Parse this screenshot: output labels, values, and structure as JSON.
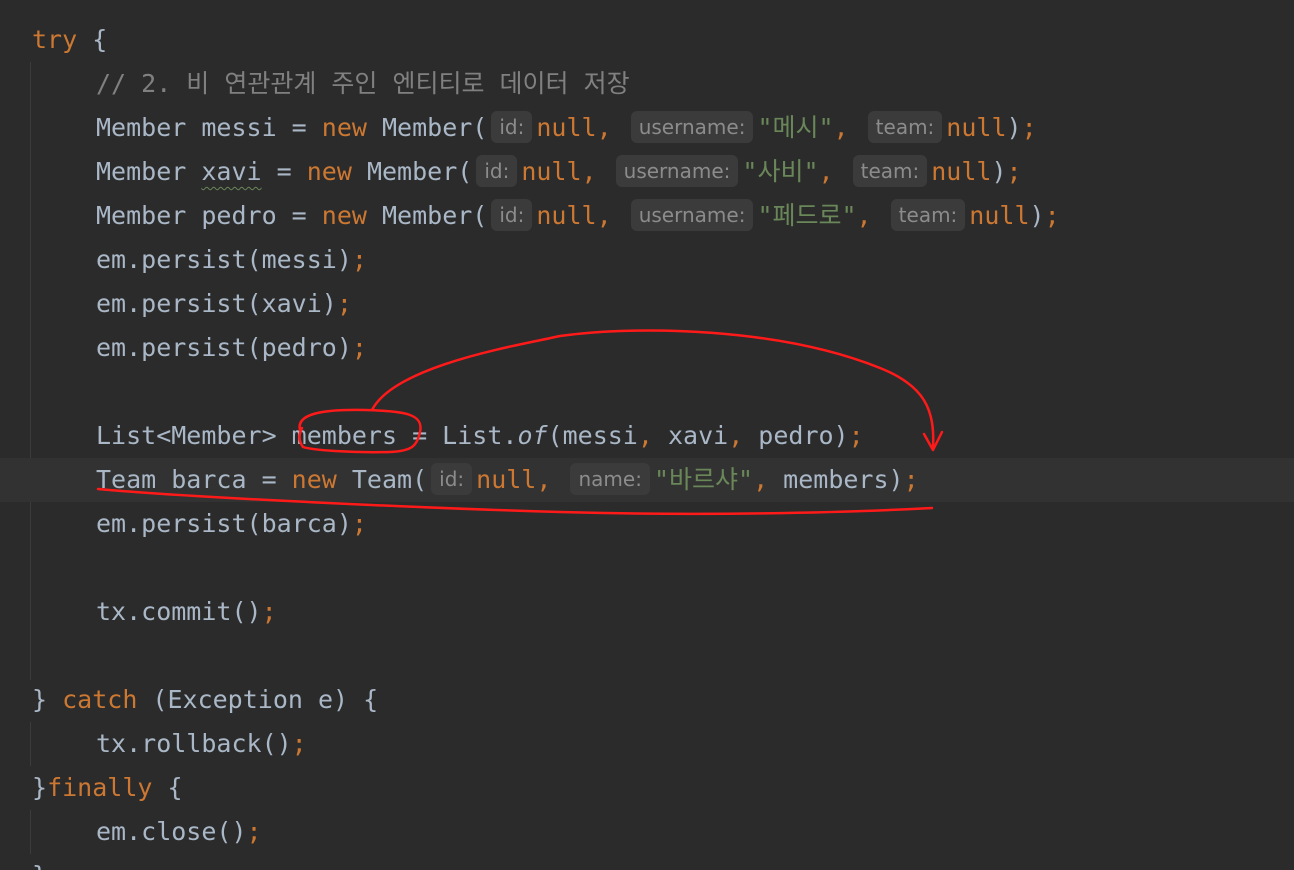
{
  "code": {
    "l1": {
      "kw": "try",
      "rest": " {"
    },
    "l2": {
      "comment": "// 2. 비 연관관계 주인 엔티티로 데이터 저장"
    },
    "l3": {
      "type": "Member",
      "var": " messi = ",
      "kw_new": "new",
      "ctor": " Member(",
      "hint_id": "id:",
      "v1": "null",
      "c1": ",",
      "hint_username": "username:",
      "v2": "\"메시\"",
      "c2": ",",
      "hint_team": "team:",
      "v3": "null",
      "close": ")",
      "semi": ";"
    },
    "l4": {
      "type": "Member ",
      "var_name": "xavi",
      "var_eq": " = ",
      "kw_new": "new",
      "ctor": " Member(",
      "hint_id": "id:",
      "v1": "null",
      "c1": ",",
      "hint_username": "username:",
      "v2": "\"사비\"",
      "c2": ",",
      "hint_team": "team:",
      "v3": "null",
      "close": ")",
      "semi": ";"
    },
    "l5": {
      "type": "Member",
      "var": " pedro = ",
      "kw_new": "new",
      "ctor": " Member(",
      "hint_id": "id:",
      "v1": "null",
      "c1": ",",
      "hint_username": "username:",
      "v2": "\"페드로\"",
      "c2": ",",
      "hint_team": "team:",
      "v3": "null",
      "close": ")",
      "semi": ";"
    },
    "l6": {
      "text": "em.persist(messi)",
      "semi": ";"
    },
    "l7": {
      "text": "em.persist(xavi)",
      "semi": ";"
    },
    "l8": {
      "text": "em.persist(pedro)",
      "semi": ";"
    },
    "l10": {
      "a": "List<Member> members = List.",
      "of": "of",
      "b": "(messi",
      "c1": ",",
      "b2": " xavi",
      "c2": ",",
      "b3": " pedro)",
      "semi": ";"
    },
    "l11": {
      "type": "Team barca = ",
      "kw_new": "new",
      "ctor": " Team(",
      "hint_id": "id:",
      "v1": "null",
      "c1": ",",
      "hint_name": "name:",
      "v2": "\"바르샤\"",
      "c2": ",",
      "rest": " members)",
      "semi": ";"
    },
    "l12": {
      "text": "em.persist(barca)",
      "semi": ";"
    },
    "l14": {
      "text": "tx.commit()",
      "semi": ";"
    },
    "l16": {
      "a": "} ",
      "kw": "catch",
      "rest": " (Exception e) {"
    },
    "l17": {
      "text": "tx.rollback()",
      "semi": ";"
    },
    "l18": {
      "a": "}",
      "kw": "finally",
      "rest": " {"
    },
    "l19": {
      "text": "em.close()",
      "semi": ";"
    },
    "l20": {
      "text": "}"
    }
  },
  "colors": {
    "background": "#2b2b2b",
    "current_line": "#323232",
    "text": "#a9b7c6",
    "keyword": "#cc7832",
    "comment": "#808080",
    "string": "#6a8759",
    "annotation": "#ff1a1a"
  }
}
